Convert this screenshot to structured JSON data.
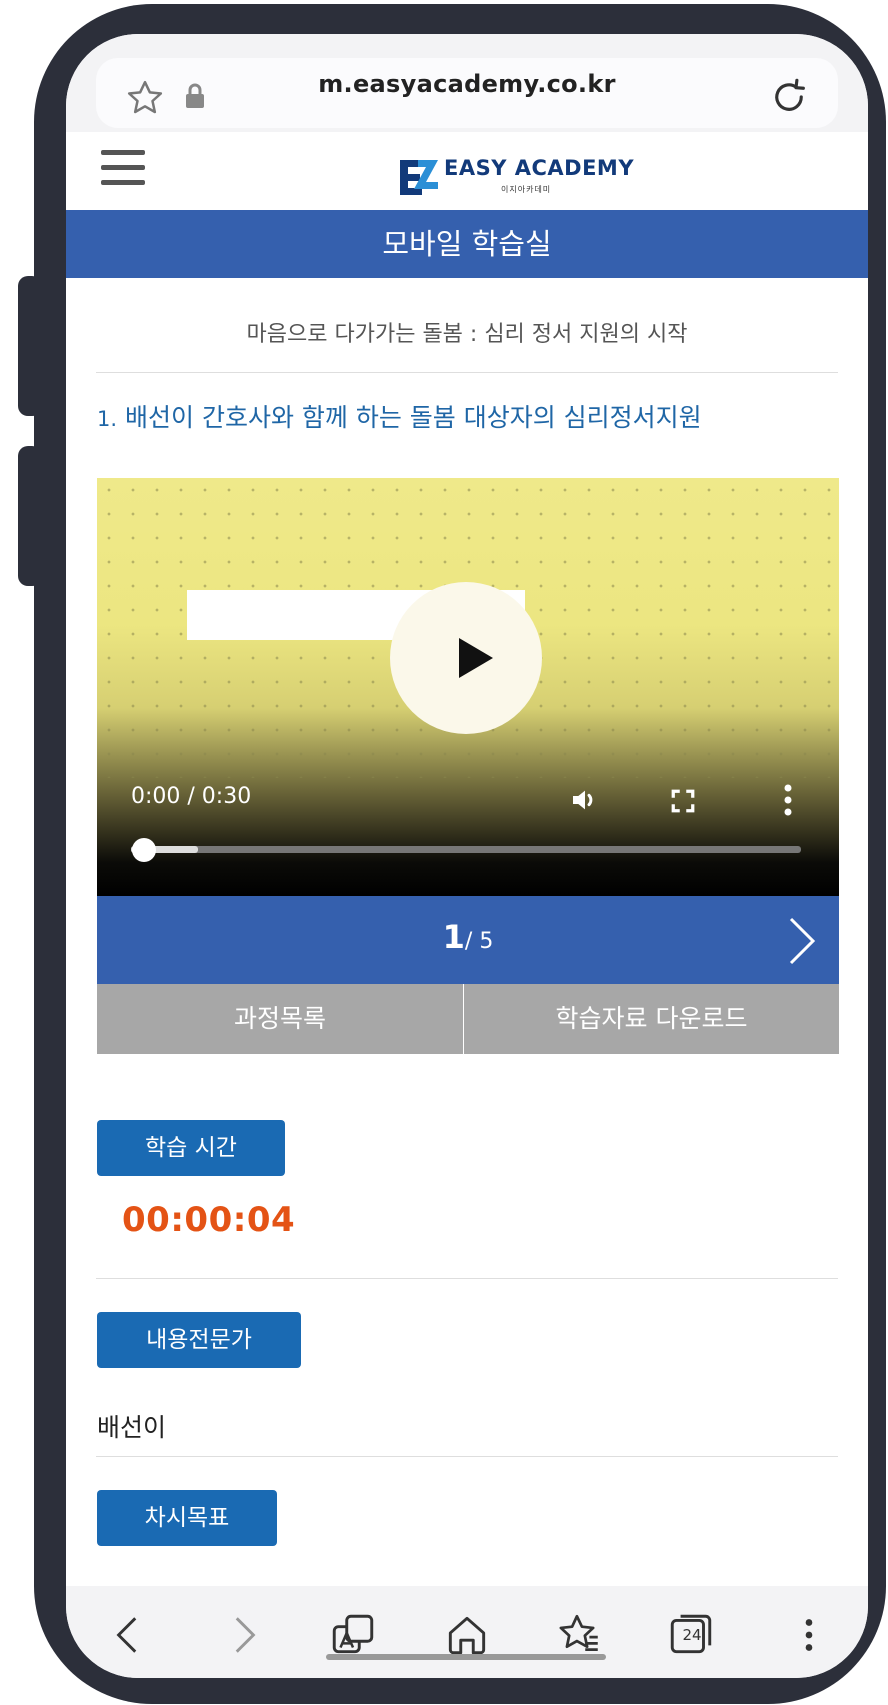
{
  "browser": {
    "url": "m.easyacademy.co.kr",
    "icons": [
      "star-icon",
      "lock-icon",
      "refresh-icon"
    ]
  },
  "site": {
    "logo_title": "EASY ACADEMY",
    "logo_subtitle": "이지아카데미",
    "banner_title": "모바일 학습실"
  },
  "course": {
    "title": "마음으로 다가가는 돌봄 : 심리 정서 지원의 시작",
    "lesson_number": "1.",
    "lesson_title": "배선이 간호사와 함께 하는 돌봄 대상자의 심리정서지원"
  },
  "video": {
    "time": "0:00 / 0:30",
    "progress": 0.1,
    "icons": [
      "play-icon",
      "volume-icon",
      "fullscreen-icon",
      "more-vertical-icon"
    ]
  },
  "pager": {
    "current": "1",
    "total": "/ 5",
    "next_icon": "chevron-right-icon"
  },
  "actions": {
    "course_list": "과정목록",
    "download": "학습자료 다운로드"
  },
  "study_time": {
    "label": "학습 시간",
    "value": "00:00:04"
  },
  "expert": {
    "label": "내용전문가",
    "name": "배선이"
  },
  "objective": {
    "label": "차시목표"
  },
  "bottom_nav": {
    "tab_count": "24",
    "icons": [
      "back-icon",
      "forward-icon",
      "translate-icon",
      "home-icon",
      "bookmarks-icon",
      "tabs-icon",
      "menu-icon"
    ]
  },
  "colors": {
    "primary_blue": "#3560ae",
    "pill_blue": "#1a6ab3",
    "timer_orange": "#e45315",
    "gray_button": "#a7a7a7"
  }
}
